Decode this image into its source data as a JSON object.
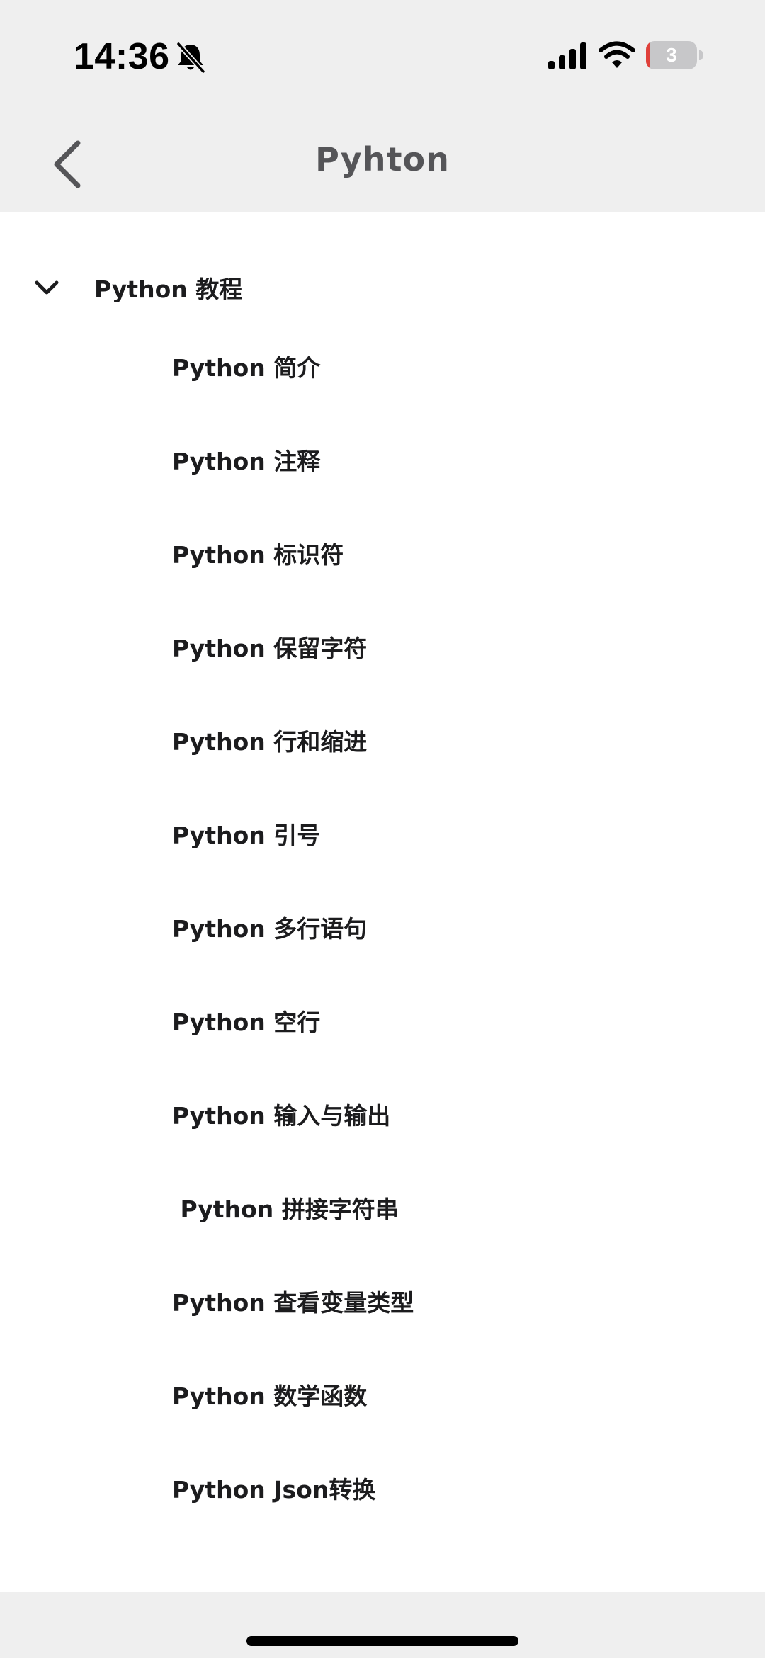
{
  "status_bar": {
    "time": "14:36",
    "battery_level": "3",
    "battery_fraction": 0.03,
    "icons": [
      "bell-slash-icon",
      "signal-icon",
      "wifi-icon",
      "battery-icon"
    ]
  },
  "nav": {
    "title": "Pyhton",
    "back_icon": "chevron-left-icon"
  },
  "section": {
    "title": "Python 教程",
    "expanded": true,
    "icon": "chevron-down-icon",
    "items": [
      {
        "label": "Python 简介"
      },
      {
        "label": "Python 注释"
      },
      {
        "label": "Python 标识符"
      },
      {
        "label": "Python 保留字符"
      },
      {
        "label": "Python 行和缩进"
      },
      {
        "label": "Python 引号"
      },
      {
        "label": "Python 多行语句"
      },
      {
        "label": "Python 空行"
      },
      {
        "label": "Python 输入与输出"
      },
      {
        "label": " Python 拼接字符串"
      },
      {
        "label": "Python 查看变量类型"
      },
      {
        "label": "Python 数学函数"
      },
      {
        "label": "Python Json转换"
      }
    ]
  },
  "colors": {
    "chrome_background": "#efefef",
    "content_background": "#ffffff",
    "text": "#1c1c1e",
    "nav_title": "#555558",
    "battery_low": "#e0403a"
  }
}
